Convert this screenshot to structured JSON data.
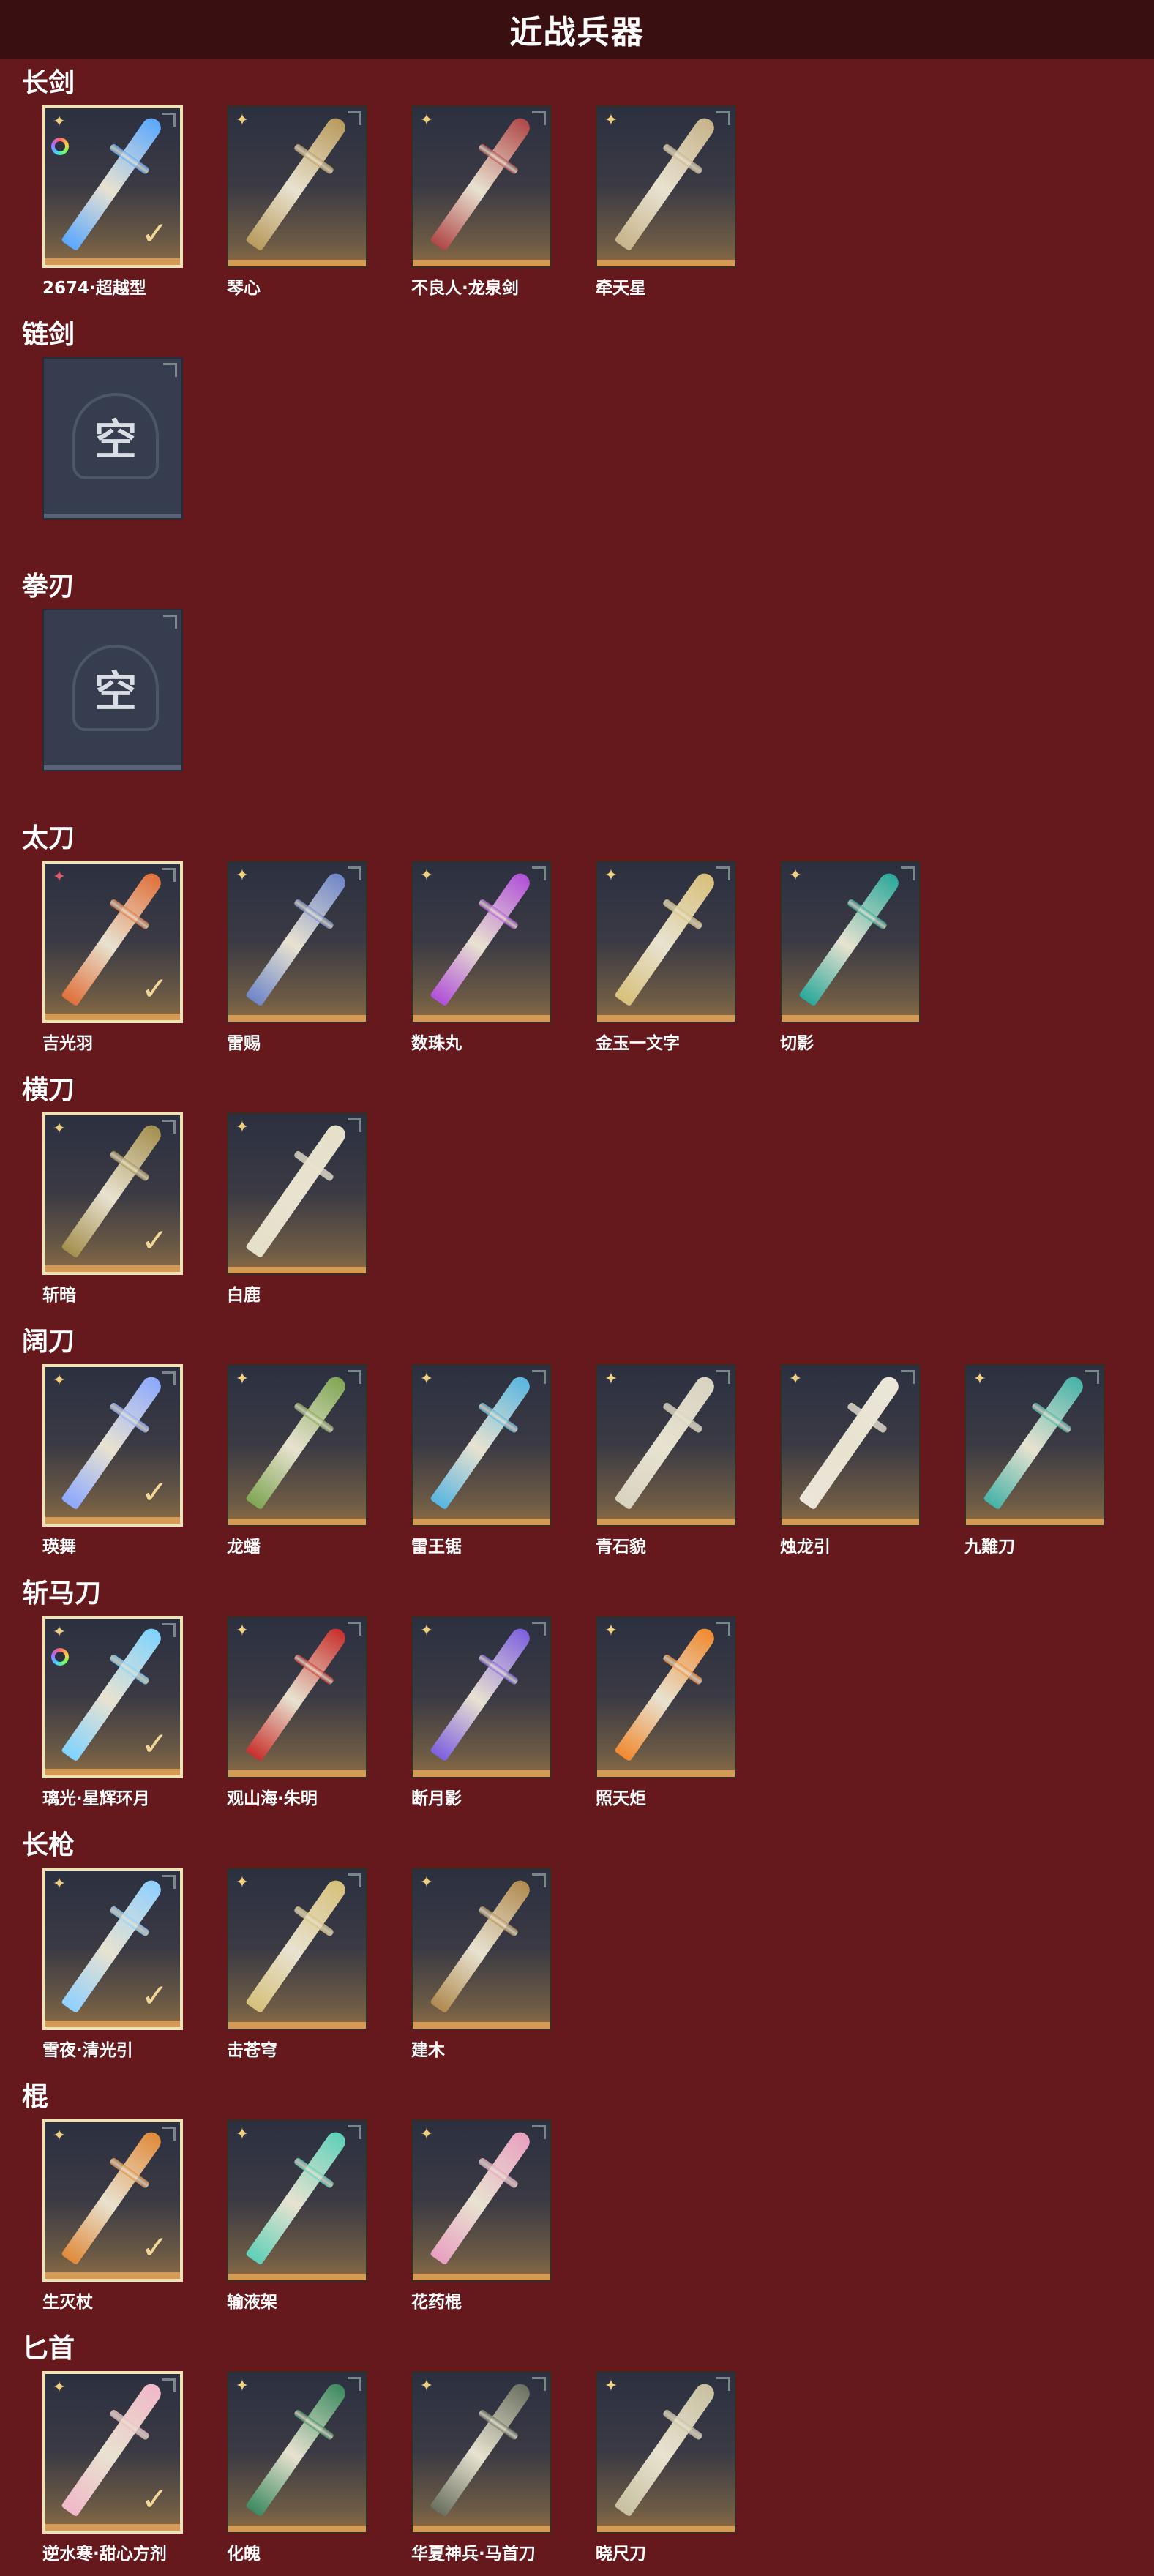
{
  "page": {
    "title": "近战兵器"
  },
  "categories": [
    {
      "name": "长剑",
      "weapons": [
        {
          "name": "2674·超越型",
          "selected": true,
          "badge": "star",
          "ring": true,
          "color": "#5aa8ff"
        },
        {
          "name": "琴心",
          "badge": "star",
          "color": "#b89a5c"
        },
        {
          "name": "不良人·龙泉剑",
          "badge": "star",
          "color": "#b04848"
        },
        {
          "name": "牵天星",
          "badge": "star",
          "color": "#c7b38a"
        }
      ]
    },
    {
      "name": "链剑",
      "weapons": [
        {
          "empty": true,
          "empty_text": "空"
        }
      ]
    },
    {
      "name": "拳刃",
      "weapons": [
        {
          "empty": true,
          "empty_text": "空"
        }
      ]
    },
    {
      "name": "太刀",
      "weapons": [
        {
          "name": "吉光羽",
          "selected": true,
          "badge": "star-red",
          "color": "#e0703a"
        },
        {
          "name": "雷赐",
          "badge": "star",
          "color": "#6f86c8"
        },
        {
          "name": "数珠丸",
          "badge": "star",
          "color": "#b050d8"
        },
        {
          "name": "金玉一文字",
          "badge": "star",
          "color": "#d7c07a"
        },
        {
          "name": "切影",
          "badge": "star",
          "color": "#2aa89a"
        }
      ]
    },
    {
      "name": "横刀",
      "weapons": [
        {
          "name": "斩暗",
          "selected": true,
          "badge": "star",
          "color": "#a38f4e"
        },
        {
          "name": "白鹿",
          "badge": "star",
          "color": "#e5e0c8"
        }
      ]
    },
    {
      "name": "阔刀",
      "weapons": [
        {
          "name": "瑛舞",
          "selected": true,
          "badge": "star",
          "color": "#8ca8ff"
        },
        {
          "name": "龙蟠",
          "badge": "star",
          "color": "#7fa654"
        },
        {
          "name": "雷王锯",
          "badge": "star",
          "color": "#58b5e0"
        },
        {
          "name": "青石貌",
          "badge": "star",
          "color": "#d8d2c0"
        },
        {
          "name": "烛龙引",
          "badge": "star",
          "color": "#ece6da"
        },
        {
          "name": "九難刀",
          "badge": "star",
          "color": "#46b2a8"
        }
      ]
    },
    {
      "name": "斩马刀",
      "weapons": [
        {
          "name": "璃光·星辉环月",
          "selected": true,
          "badge": "star",
          "ring": true,
          "color": "#7fd3ff"
        },
        {
          "name": "观山海·朱明",
          "badge": "star",
          "color": "#c8302c"
        },
        {
          "name": "断月影",
          "badge": "star",
          "color": "#7d60e0"
        },
        {
          "name": "照天炬",
          "badge": "star",
          "color": "#f08a30"
        }
      ]
    },
    {
      "name": "长枪",
      "weapons": [
        {
          "name": "雪夜·清光引",
          "selected": true,
          "badge": "star",
          "color": "#8fd0ff"
        },
        {
          "name": "击苍穹",
          "badge": "star",
          "color": "#d6c07a"
        },
        {
          "name": "建木",
          "badge": "star",
          "color": "#b08a50"
        }
      ]
    },
    {
      "name": "棍",
      "weapons": [
        {
          "name": "生灭杖",
          "selected": true,
          "badge": "star",
          "color": "#e08a3a"
        },
        {
          "name": "输液架",
          "badge": "star",
          "color": "#5ed0b8"
        },
        {
          "name": "花药棍",
          "badge": "star",
          "color": "#e8a0c0"
        }
      ]
    },
    {
      "name": "匕首",
      "weapons": [
        {
          "name": "逆水寒·甜心方剂",
          "selected": true,
          "badge": "star",
          "color": "#f0b8c8"
        },
        {
          "name": "化魄",
          "badge": "star",
          "color": "#3c8a60"
        },
        {
          "name": "华夏神兵·马首刀",
          "badge": "star",
          "color": "#6a7060"
        },
        {
          "name": "晓尺刀",
          "badge": "star",
          "color": "#c8c0a0"
        }
      ]
    }
  ],
  "icons": {
    "badge": "four-point-star-icon",
    "selected": "checkmark-icon",
    "ring": "rainbow-ring-icon"
  }
}
